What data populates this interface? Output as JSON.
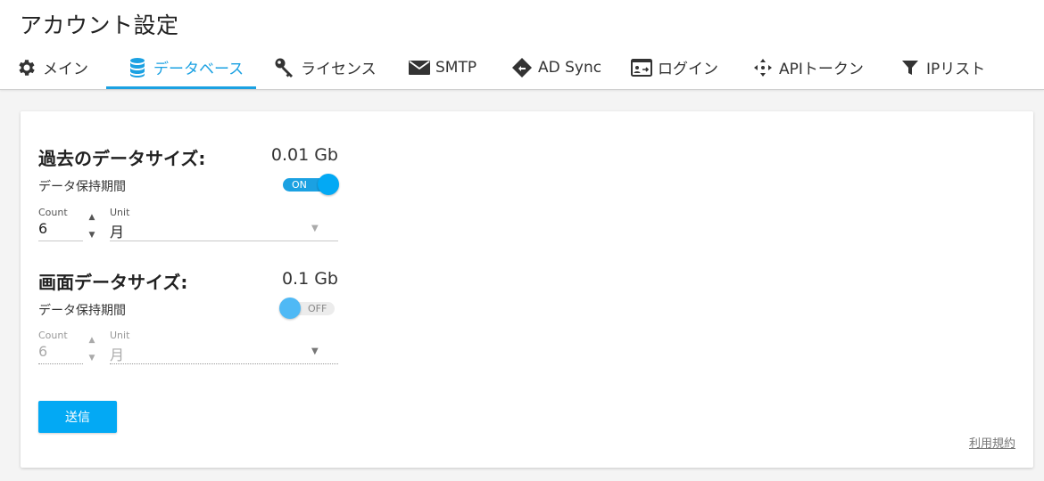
{
  "page_title": "アカウント設定",
  "tabs": [
    {
      "label": "メイン",
      "icon": "gear-icon",
      "active": false
    },
    {
      "label": "データベース",
      "icon": "database-icon",
      "active": true
    },
    {
      "label": "ライセンス",
      "icon": "key-icon",
      "active": false
    },
    {
      "label": "SMTP",
      "icon": "envelope-icon",
      "active": false
    },
    {
      "label": "AD Sync",
      "icon": "sync-diamond-icon",
      "active": false
    },
    {
      "label": "ログイン",
      "icon": "login-card-icon",
      "active": false
    },
    {
      "label": "APIトークン",
      "icon": "api-arrows-icon",
      "active": false
    },
    {
      "label": "IPリスト",
      "icon": "filter-icon",
      "active": false
    }
  ],
  "colors": {
    "accent": "#1ba1e2",
    "button": "#03a9f4"
  },
  "history": {
    "title": "過去のデータサイズ:",
    "size": "0.01 Gb",
    "retention_label": "データ保持期間",
    "toggle_on": true,
    "toggle_text": "ON",
    "count_label": "Count",
    "count_value": "6",
    "unit_label": "Unit",
    "unit_value": "月"
  },
  "screen": {
    "title": "画面データサイズ:",
    "size": "0.1 Gb",
    "retention_label": "データ保持期間",
    "toggle_on": false,
    "toggle_text": "OFF",
    "count_label": "Count",
    "count_value": "6",
    "unit_label": "Unit",
    "unit_value": "月"
  },
  "submit_label": "送信",
  "terms_label": "利用規約"
}
